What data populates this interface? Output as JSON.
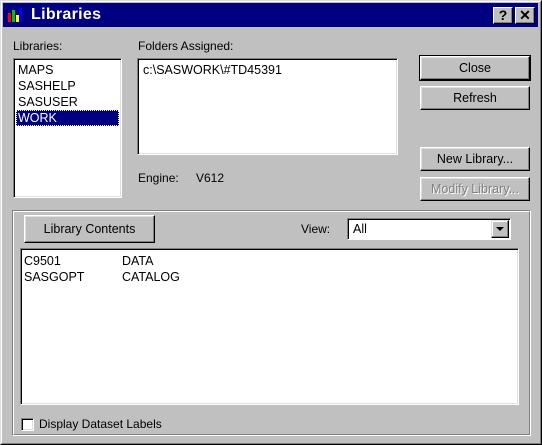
{
  "window": {
    "title": "Libraries",
    "help_button": "?",
    "close_button": "✕"
  },
  "libraries": {
    "label": "Libraries:",
    "items": [
      "MAPS",
      "SASHELP",
      "SASUSER",
      "WORK"
    ],
    "selected": "WORK"
  },
  "folders": {
    "label": "Folders Assigned:",
    "paths": [
      "c:\\SASWORK\\#TD45391"
    ]
  },
  "engine": {
    "label": "Engine:",
    "value": "V612"
  },
  "buttons": {
    "close": "Close",
    "refresh": "Refresh",
    "new_library": "New Library...",
    "modify_library": "Modify Library...",
    "library_contents": "Library Contents"
  },
  "view": {
    "label": "View:",
    "selected": "All"
  },
  "contents": {
    "rows": [
      {
        "name": "C9501",
        "type": "DATA"
      },
      {
        "name": "SASGOPT",
        "type": "CATALOG"
      }
    ]
  },
  "options": {
    "display_labels": "Display Dataset Labels",
    "display_labels_checked": false
  },
  "colors": {
    "titlebar": "#000080",
    "selection": "#000080",
    "face": "#c0c0c0"
  }
}
